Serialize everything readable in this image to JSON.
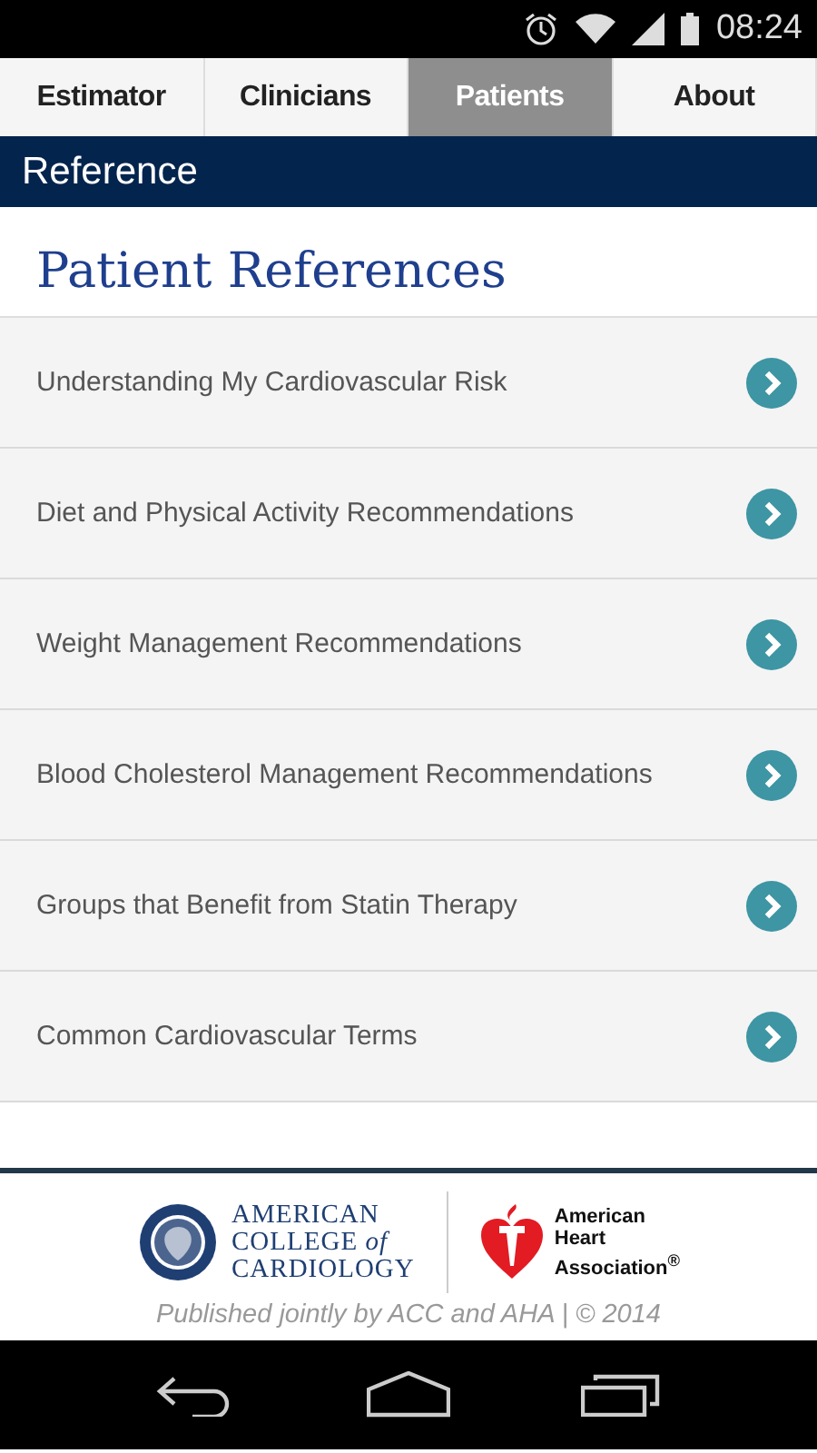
{
  "status_bar": {
    "time": "08:24"
  },
  "tabs": [
    {
      "label": "Estimator",
      "selected": false
    },
    {
      "label": "Clinicians",
      "selected": false
    },
    {
      "label": "Patients",
      "selected": true
    },
    {
      "label": "About",
      "selected": false
    }
  ],
  "section_header": "Reference",
  "page_title": "Patient References",
  "references": [
    {
      "label": "Understanding My Cardiovascular Risk"
    },
    {
      "label": "Diet and Physical Activity Recommendations"
    },
    {
      "label": "Weight Management Recommendations"
    },
    {
      "label": "Blood Cholesterol Management Recommendations"
    },
    {
      "label": "Groups that Benefit from Statin Therapy"
    },
    {
      "label": "Common Cardiovascular Terms"
    }
  ],
  "footer": {
    "acc_logo_text": "AMERICAN\nCOLLEGE *of*\nCARDIOLOGY",
    "aha_logo_text": "American\nHeart\nAssociation$^{®}$",
    "credit": "Published jointly by ACC and AHA | © 2014"
  }
}
